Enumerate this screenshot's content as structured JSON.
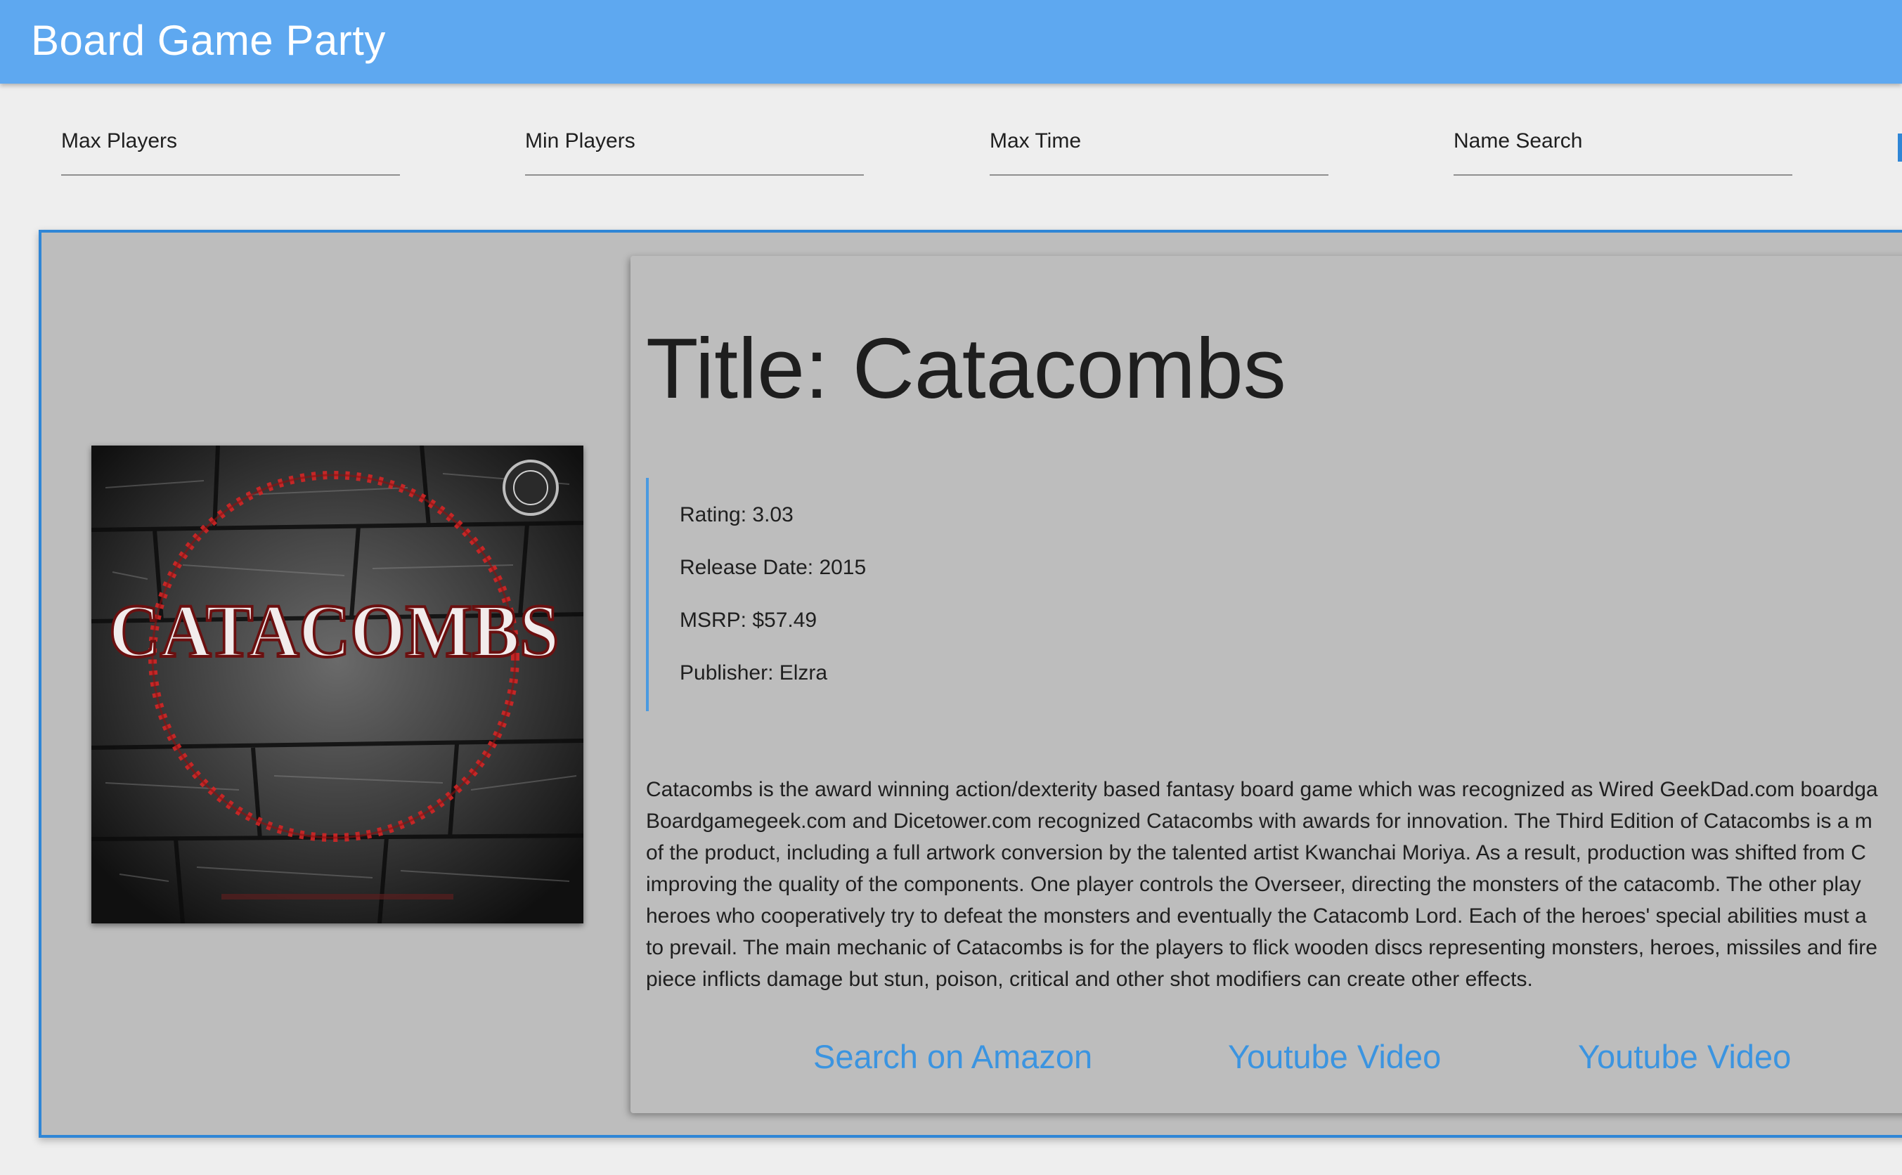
{
  "app": {
    "title": "Board Game Party"
  },
  "filters": {
    "max_players": {
      "label": "Max Players",
      "value": ""
    },
    "min_players": {
      "label": "Min Players",
      "value": ""
    },
    "max_time": {
      "label": "Max Time",
      "value": ""
    },
    "name_search": {
      "label": "Name Search",
      "value": ""
    }
  },
  "game": {
    "title": "Title: Catacombs",
    "cover_text": "CATACOMBS",
    "rating": "Rating: 3.03",
    "release_date": "Release Date: 2015",
    "msrp": "MSRP: $57.49",
    "publisher": "Publisher: Elzra",
    "description_lines": [
      "Catacombs is the award winning action/dexterity based fantasy board game which was recognized as Wired GeekDad.com boardga",
      "Boardgamegeek.com and Dicetower.com recognized Catacombs with awards for innovation. The Third Edition of Catacombs is a m",
      "of the product, including a full artwork conversion by the talented artist Kwanchai Moriya. As a result, production was shifted from C",
      "improving the quality of the components. One player controls the Overseer, directing the monsters of the catacomb. The other play",
      "heroes who cooperatively try to defeat the monsters and eventually the Catacomb Lord. Each of the heroes' special abilities must a",
      "to prevail. The main mechanic of Catacombs is for the players to flick wooden discs representing monsters, heroes, missiles and fire",
      "piece inflicts damage but stun, poison, critical and other shot modifiers can create other effects."
    ],
    "links": {
      "amazon": "Search on Amazon",
      "youtube_1": "Youtube Video",
      "youtube_2": "Youtube Video"
    }
  },
  "colors": {
    "app_bar": "#5ea8f0",
    "accent": "#2f86d6",
    "link": "#3b94e0",
    "card_bg": "#bdbdbd",
    "page_bg": "#eeeeee"
  }
}
